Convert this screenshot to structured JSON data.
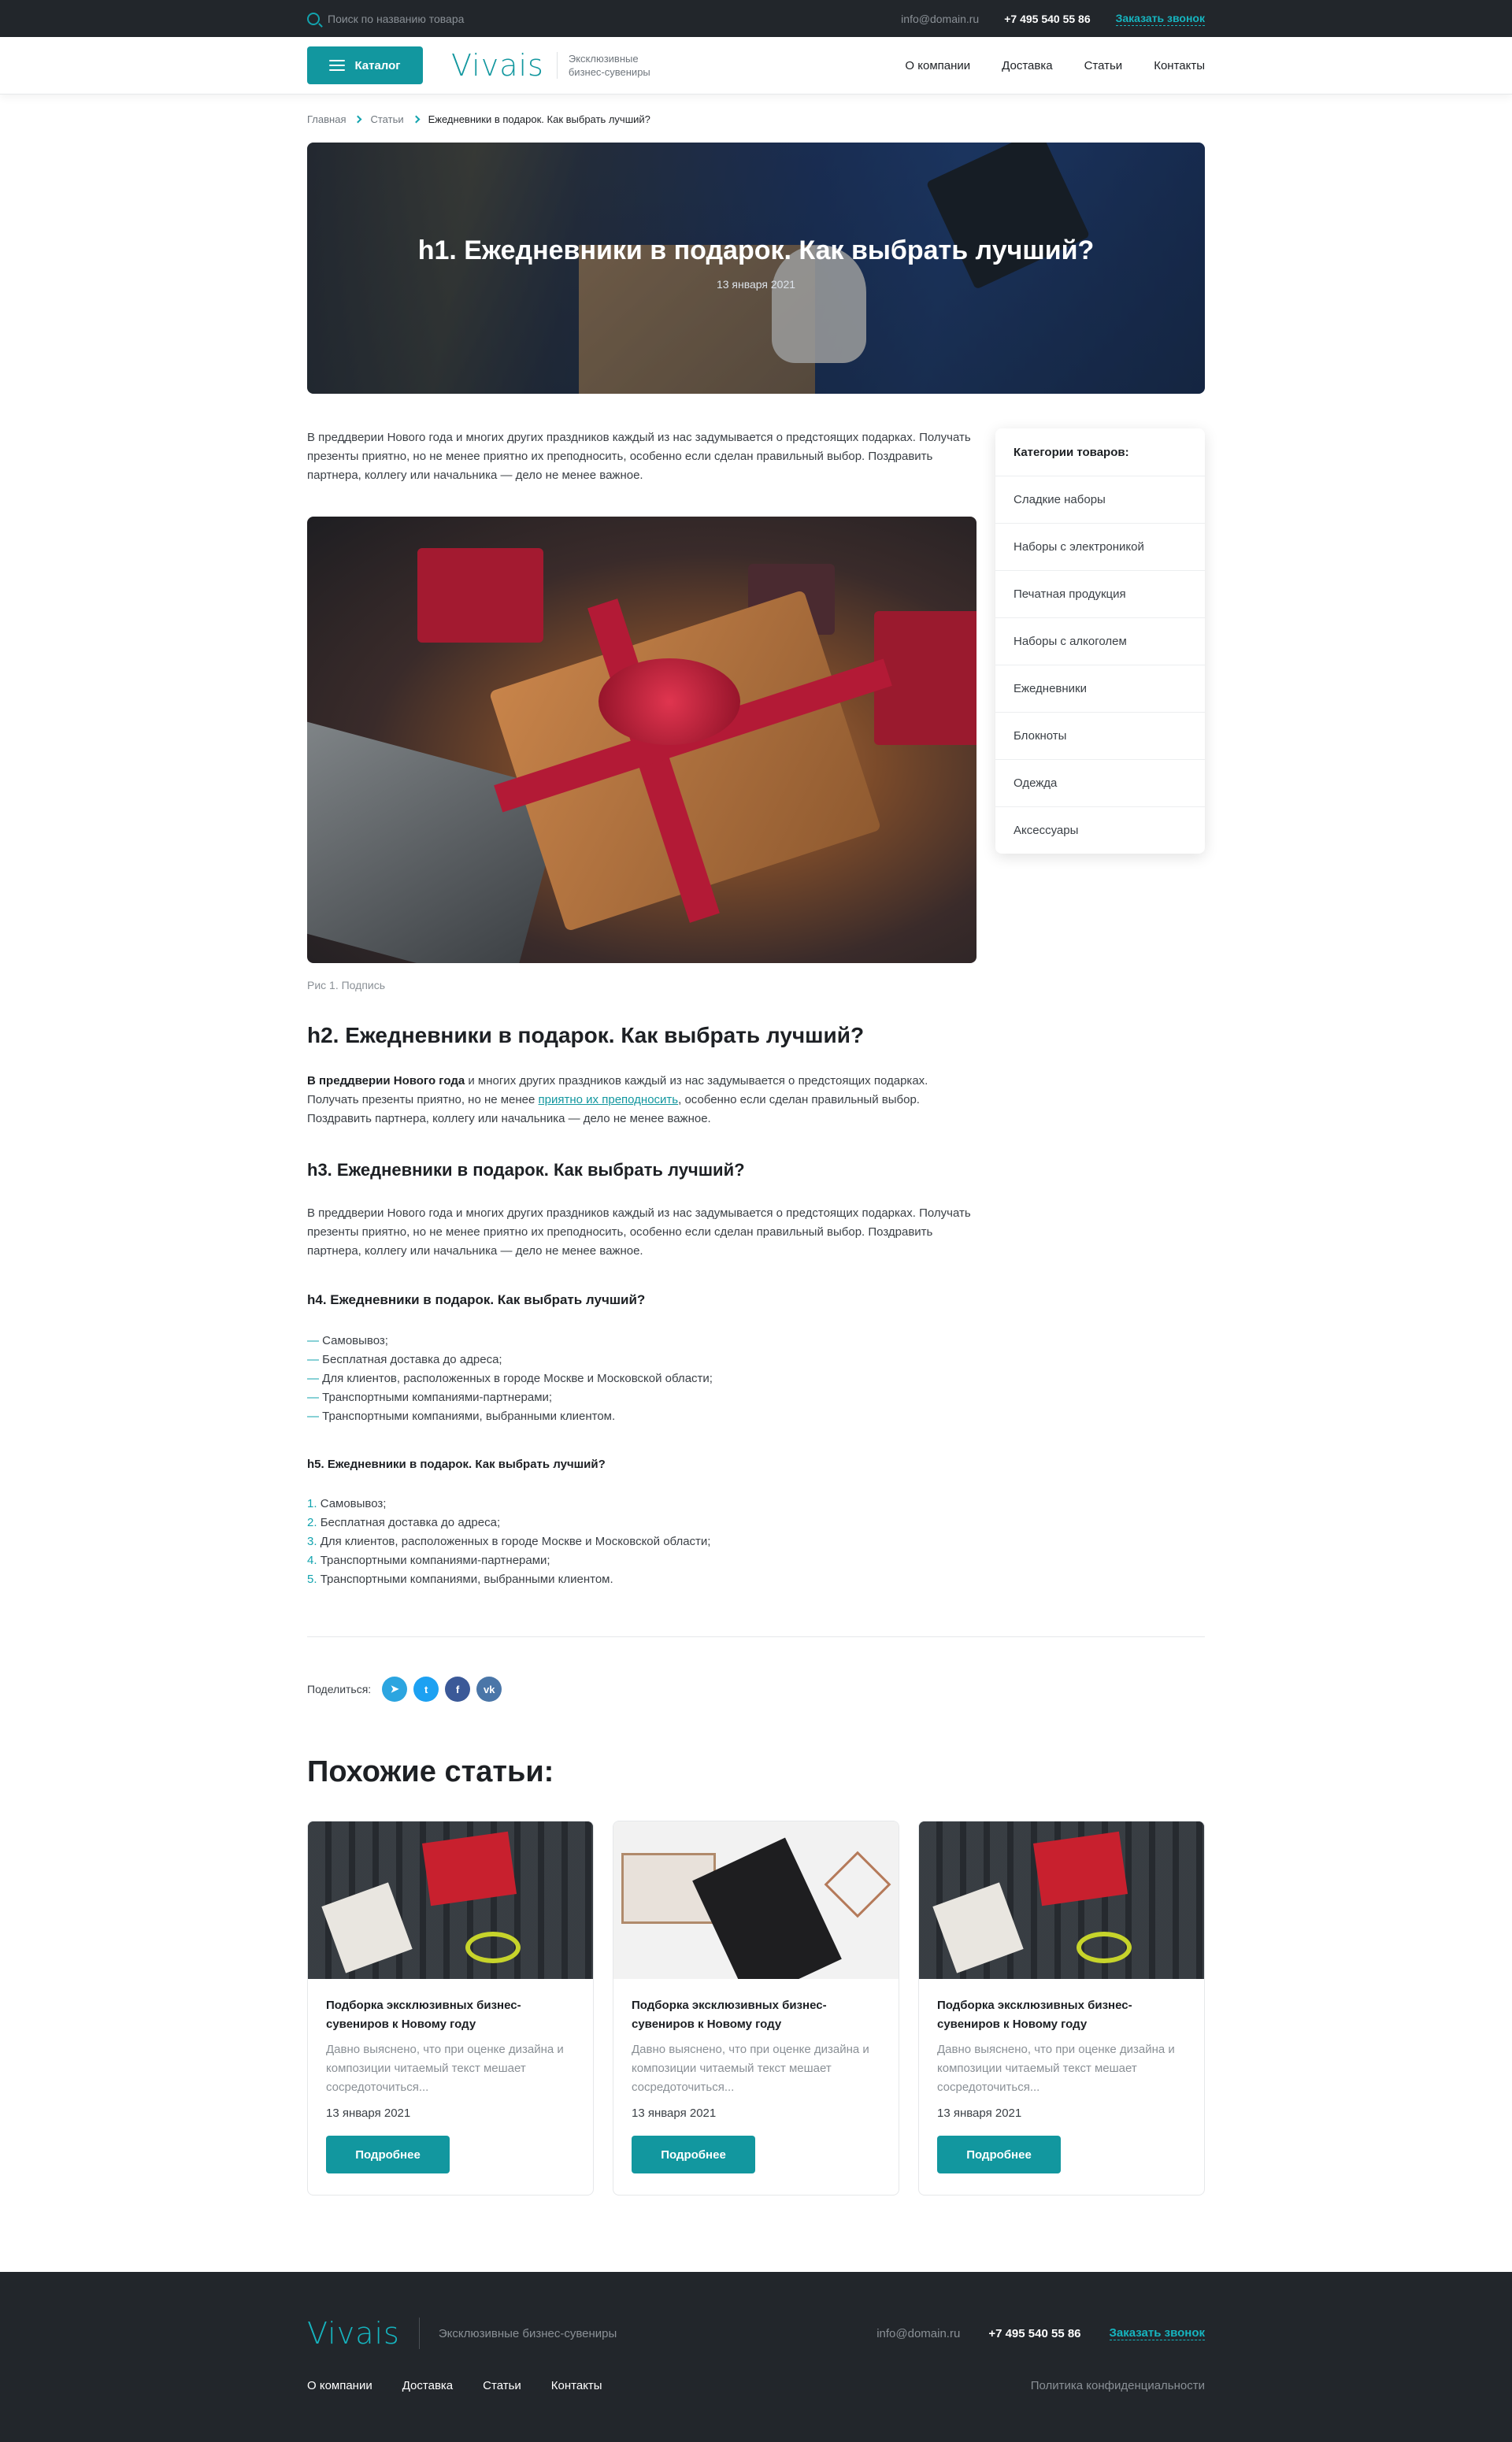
{
  "topbar": {
    "search_placeholder": "Поиск по названию товара",
    "email": "info@domain.ru",
    "phone": "+7 495 540 55 86",
    "callback": "Заказать звонок"
  },
  "header": {
    "catalog_label": "Каталог",
    "logo": "Vivais",
    "tagline": "Эксклюзивные бизнес-сувениры",
    "nav": [
      "О компании",
      "Доставка",
      "Статьи",
      "Контакты"
    ]
  },
  "breadcrumbs": [
    "Главная",
    "Статьи",
    "Ежедневники в подарок. Как выбрать лучший?"
  ],
  "hero": {
    "title": "h1. Ежедневники в подарок. Как выбрать лучший?",
    "date": "13 января 2021"
  },
  "article": {
    "lead": "В преддверии Нового года и многих других праздников каждый из нас задумывается о предстоящих подарках. Получать презенты приятно, но не менее приятно их преподносить, особенно если сделан правильный выбор. Поздравить партнера, коллегу или начальника — дело не менее важное.",
    "caption": "Рис 1. Подпись",
    "h2": "h2. Ежедневники в подарок. Как выбрать лучший?",
    "p2_bold": "В преддверии Нового года",
    "p2_mid": " и многих других праздников каждый из нас задумывается о предстоящих подарках. Получать презенты приятно, но не менее ",
    "p2_link": "приятно их преподносить",
    "p2_end": ", особенно если сделан правильный выбор. Поздравить партнера, коллегу или начальника — дело не менее важное.",
    "h3": "h3. Ежедневники в подарок. Как выбрать лучший?",
    "p3": "В преддверии Нового года и многих других праздников каждый из нас задумывается о предстоящих подарках. Получать презенты приятно, но не менее приятно их преподносить, особенно если сделан правильный выбор. Поздравить партнера, коллегу или начальника — дело не менее важное.",
    "h4": "h4. Ежедневники в подарок. Как выбрать лучший?",
    "list_dash": [
      "Самовывоз;",
      "Бесплатная доставка до адреса;",
      "Для клиентов, расположенных в городе Москве и Московской области;",
      "Транспортными компаниями-партнерами;",
      "Транспортными компаниями, выбранными клиентом."
    ],
    "h5": "h5. Ежедневники в подарок. Как выбрать лучший?",
    "list_num": [
      "Самовывоз;",
      "Бесплатная доставка до адреса;",
      "Для клиентов, расположенных в городе Москве и Московской области;",
      "Транспортными компаниями-партнерами;",
      "Транспортными компаниями, выбранными клиентом."
    ]
  },
  "categories": {
    "title": "Категории товаров:",
    "items": [
      "Сладкие наборы",
      "Наборы с электроникой",
      "Печатная продукция",
      "Наборы с алкоголем",
      "Ежедневники",
      "Блокноты",
      "Одежда",
      "Аксессуары"
    ]
  },
  "share": {
    "label": "Поделиться:",
    "networks": [
      {
        "icon": "telegram-icon",
        "glyph": "➤",
        "color": "#2ca5e0"
      },
      {
        "icon": "twitter-icon",
        "glyph": "t",
        "color": "#1da1f2"
      },
      {
        "icon": "facebook-icon",
        "glyph": "f",
        "color": "#3b5998"
      },
      {
        "icon": "vk-icon",
        "glyph": "vk",
        "color": "#4a76a8"
      }
    ]
  },
  "similar": {
    "title": "Похожие статьи:",
    "cards": [
      {
        "title": "Подборка эксклюзивных бизнес-сувениров к Новому году",
        "text": "Давно выяснено, что при оценке дизайна и композиции читаемый текст мешает сосредоточиться...",
        "date": "13 января 2021",
        "button": "Подробнее"
      },
      {
        "title": "Подборка эксклюзивных бизнес-сувениров к Новому году",
        "text": "Давно выяснено, что при оценке дизайна и композиции читаемый текст мешает сосредоточиться...",
        "date": "13 января 2021",
        "button": "Подробнее"
      },
      {
        "title": "Подборка эксклюзивных бизнес-сувениров к Новому году",
        "text": "Давно выяснено, что при оценке дизайна и композиции читаемый текст мешает сосредоточиться...",
        "date": "13 января 2021",
        "button": "Подробнее"
      }
    ]
  },
  "footer": {
    "logo": "Vivais",
    "tagline": "Эксклюзивные бизнес-сувениры",
    "email": "info@domain.ru",
    "phone": "+7 495 540 55 86",
    "callback": "Заказать звонок",
    "nav": [
      "О компании",
      "Доставка",
      "Статьи",
      "Контакты"
    ],
    "privacy": "Политика конфиденциальности"
  },
  "colors": {
    "accent": "#12979f",
    "dark": "#22262b"
  }
}
